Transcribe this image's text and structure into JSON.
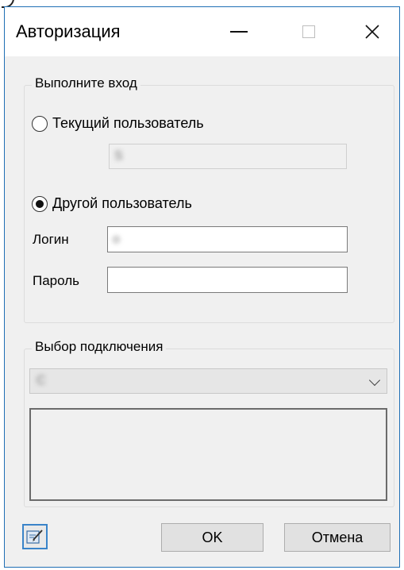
{
  "window": {
    "title": "Авторизация"
  },
  "login_group": {
    "title": "Выполните вход",
    "current_user": {
      "label": "Текущий пользователь",
      "selected": false,
      "value": "S"
    },
    "other_user": {
      "label": "Другой пользователь",
      "selected": true
    },
    "login": {
      "label": "Логин",
      "value": "o"
    },
    "password": {
      "label": "Пароль",
      "value": ""
    }
  },
  "connection_group": {
    "title": "Выбор подключения",
    "selected": "C",
    "info_lines": [
      "",
      ""
    ]
  },
  "buttons": {
    "ok": "OK",
    "cancel": "Отмена",
    "edit_icon": "edit-connection-icon"
  },
  "colors": {
    "window_border": "#1f6fb5",
    "accent": "#3a84c9"
  }
}
